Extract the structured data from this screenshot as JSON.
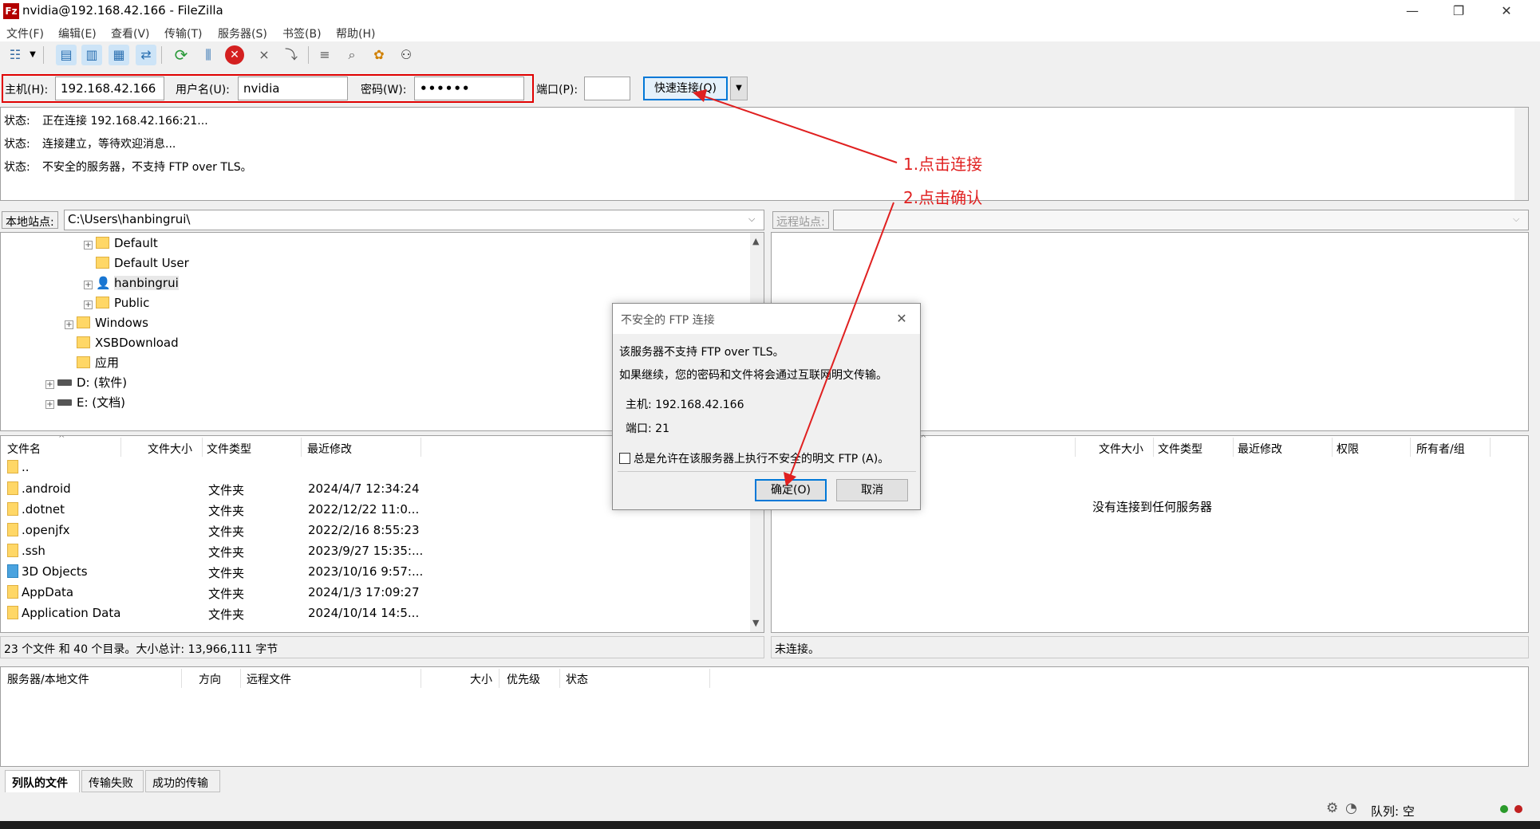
{
  "window": {
    "title": "nvidia@192.168.42.166 - FileZilla",
    "icon": "Fz",
    "controls": {
      "minimize": "—",
      "maximize": "❐",
      "close": "✕"
    }
  },
  "menu": [
    "文件(F)",
    "编辑(E)",
    "查看(V)",
    "传输(T)",
    "服务器(S)",
    "书签(B)",
    "帮助(H)"
  ],
  "quickconnect": {
    "host_label": "主机(H):",
    "host_value": "192.168.42.166",
    "user_label": "用户名(U):",
    "user_value": "nvidia",
    "pass_label": "密码(W):",
    "pass_value": "••••••",
    "port_label": "端口(P):",
    "port_value": "",
    "connect_label": "快速连接(Q)",
    "dropdown": "▼"
  },
  "log": [
    {
      "label": "状态:",
      "text": "正在连接 192.168.42.166:21..."
    },
    {
      "label": "状态:",
      "text": "连接建立，等待欢迎消息..."
    },
    {
      "label": "状态:",
      "text": "不安全的服务器，不支持 FTP over TLS。"
    }
  ],
  "local": {
    "site_label": "本地站点:",
    "path": "C:\\Users\\hanbingrui\\",
    "tree": [
      {
        "name": "Default",
        "level": 3,
        "expander": "+",
        "icon": "folder"
      },
      {
        "name": "Default User",
        "level": 3,
        "expander": "",
        "icon": "folder"
      },
      {
        "name": "hanbingrui",
        "level": 3,
        "expander": "+",
        "icon": "user"
      },
      {
        "name": "Public",
        "level": 3,
        "expander": "+",
        "icon": "folder"
      },
      {
        "name": "Windows",
        "level": 2,
        "expander": "+",
        "icon": "folder"
      },
      {
        "name": "XSBDownload",
        "level": 2,
        "expander": "",
        "icon": "folder"
      },
      {
        "name": "应用",
        "level": 2,
        "expander": "",
        "icon": "folder"
      },
      {
        "name": "D: (软件)",
        "level": 1,
        "expander": "+",
        "icon": "drive"
      },
      {
        "name": "E: (文档)",
        "level": 1,
        "expander": "+",
        "icon": "drive"
      }
    ],
    "columns": [
      "文件名",
      "文件大小",
      "文件类型",
      "最近修改"
    ],
    "files": [
      {
        "name": "..",
        "type": "",
        "modified": ""
      },
      {
        "name": ".android",
        "type": "文件夹",
        "modified": "2024/4/7 12:34:24"
      },
      {
        "name": ".dotnet",
        "type": "文件夹",
        "modified": "2022/12/22 11:0..."
      },
      {
        "name": ".openjfx",
        "type": "文件夹",
        "modified": "2022/2/16 8:55:23"
      },
      {
        "name": ".ssh",
        "type": "文件夹",
        "modified": "2023/9/27 15:35:..."
      },
      {
        "name": "3D Objects",
        "type": "文件夹",
        "modified": "2023/10/16 9:57:..."
      },
      {
        "name": "AppData",
        "type": "文件夹",
        "modified": "2024/1/3 17:09:27"
      },
      {
        "name": "Application Data",
        "type": "文件夹",
        "modified": "2024/10/14 14:5..."
      }
    ],
    "status": "23 个文件 和 40 个目录。大小总计: 13,966,111 字节"
  },
  "remote": {
    "site_label": "远程站点:",
    "path": "",
    "columns": [
      "文件大小",
      "文件类型",
      "最近修改",
      "权限",
      "所有者/组"
    ],
    "empty_message": "没有连接到任何服务器",
    "status": "未连接。"
  },
  "queue": {
    "columns": [
      "服务器/本地文件",
      "方向",
      "远程文件",
      "大小",
      "优先级",
      "状态"
    ],
    "tabs": [
      "列队的文件",
      "传输失败",
      "成功的传输"
    ]
  },
  "statusbar": {
    "queue": "队列: 空"
  },
  "dialog": {
    "title": "不安全的 FTP 连接",
    "close": "✕",
    "line1": "该服务器不支持 FTP over TLS。",
    "line2": "如果继续，您的密码和文件将会通过互联网明文传输。",
    "host": "主机: 192.168.42.166",
    "port": "端口: 21",
    "checkbox_label": "总是允许在该服务器上执行不安全的明文 FTP (A)。",
    "ok": "确定(O)",
    "cancel": "取消"
  },
  "annotations": {
    "step1": "1.点击连接",
    "step2": "2.点击确认",
    "color": "#e02020"
  }
}
